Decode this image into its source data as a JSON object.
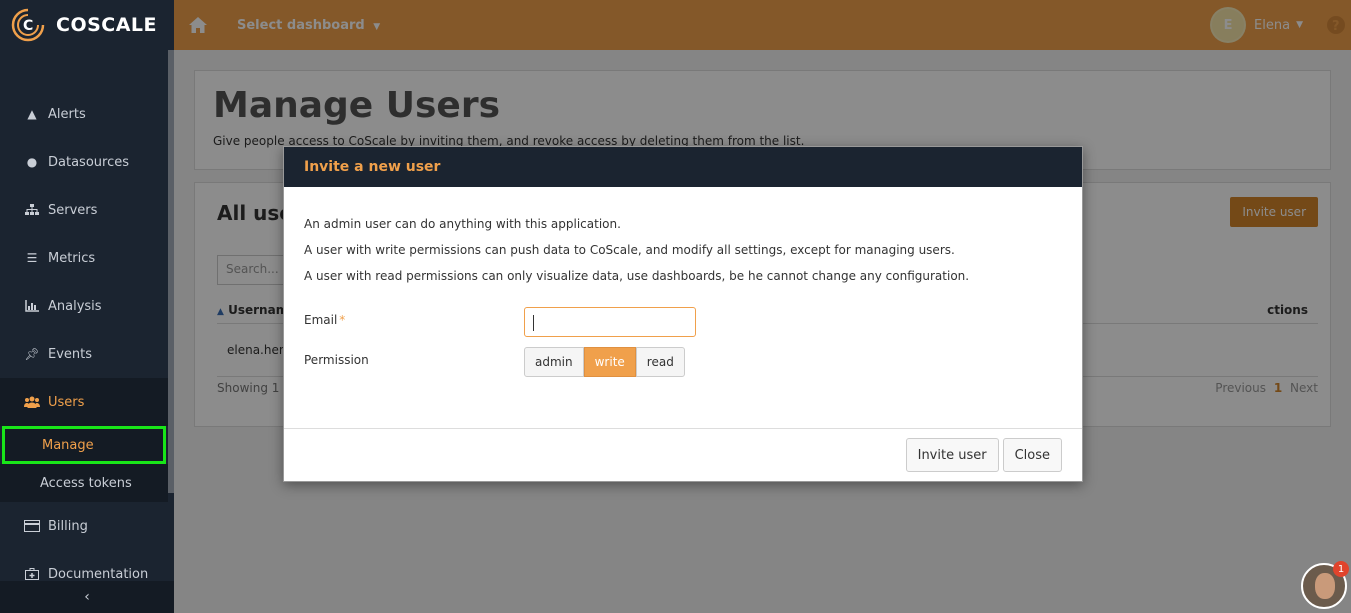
{
  "app": {
    "brand": "COSCALE"
  },
  "topbar": {
    "dashboard_select": "Select dashboard",
    "user_name": "Elena",
    "avatar_letter": "E"
  },
  "sidebar": {
    "items": [
      {
        "label": "Alerts",
        "icon": "warning-icon"
      },
      {
        "label": "Datasources",
        "icon": "globe-icon"
      },
      {
        "label": "Servers",
        "icon": "sitemap-icon"
      },
      {
        "label": "Metrics",
        "icon": "list-icon"
      },
      {
        "label": "Analysis",
        "icon": "bar-chart-icon"
      },
      {
        "label": "Events",
        "icon": "pin-icon"
      },
      {
        "label": "Users",
        "icon": "users-icon"
      },
      {
        "label": "Billing",
        "icon": "credit-card-icon"
      },
      {
        "label": "Documentation",
        "icon": "medkit-icon"
      }
    ],
    "users_sub": [
      {
        "label": "Manage"
      },
      {
        "label": "Access tokens"
      }
    ]
  },
  "page": {
    "title": "Manage Users",
    "description": "Give people access to CoScale by inviting them, and revoke access by deleting them from the list."
  },
  "list": {
    "title": "All use",
    "invite_button": "Invite user",
    "search_placeholder": "Search...",
    "col_username": "Usernam",
    "col_actions": "ctions",
    "row_user": "elena.hent",
    "showing": "Showing 1 t",
    "pager_prev": "Previous",
    "pager_current": "1",
    "pager_next": "Next"
  },
  "modal": {
    "title": "Invite a new user",
    "lines": [
      "An admin user can do anything with this application.",
      "A user with write permissions can push data to CoScale, and modify all settings, except for managing users.",
      "A user with read permissions can only visualize data, use dashboards, be he cannot change any configuration."
    ],
    "email_label": "Email",
    "required_mark": "*",
    "email_value": "",
    "permission_label": "Permission",
    "permissions": [
      "admin",
      "write",
      "read"
    ],
    "permission_selected": "write",
    "invite_button": "Invite user",
    "close_button": "Close"
  },
  "chat": {
    "badge_count": "1"
  },
  "colors": {
    "accent": "#f0a04b",
    "sidebar": "#1b2430",
    "highlight": "#19e619"
  }
}
